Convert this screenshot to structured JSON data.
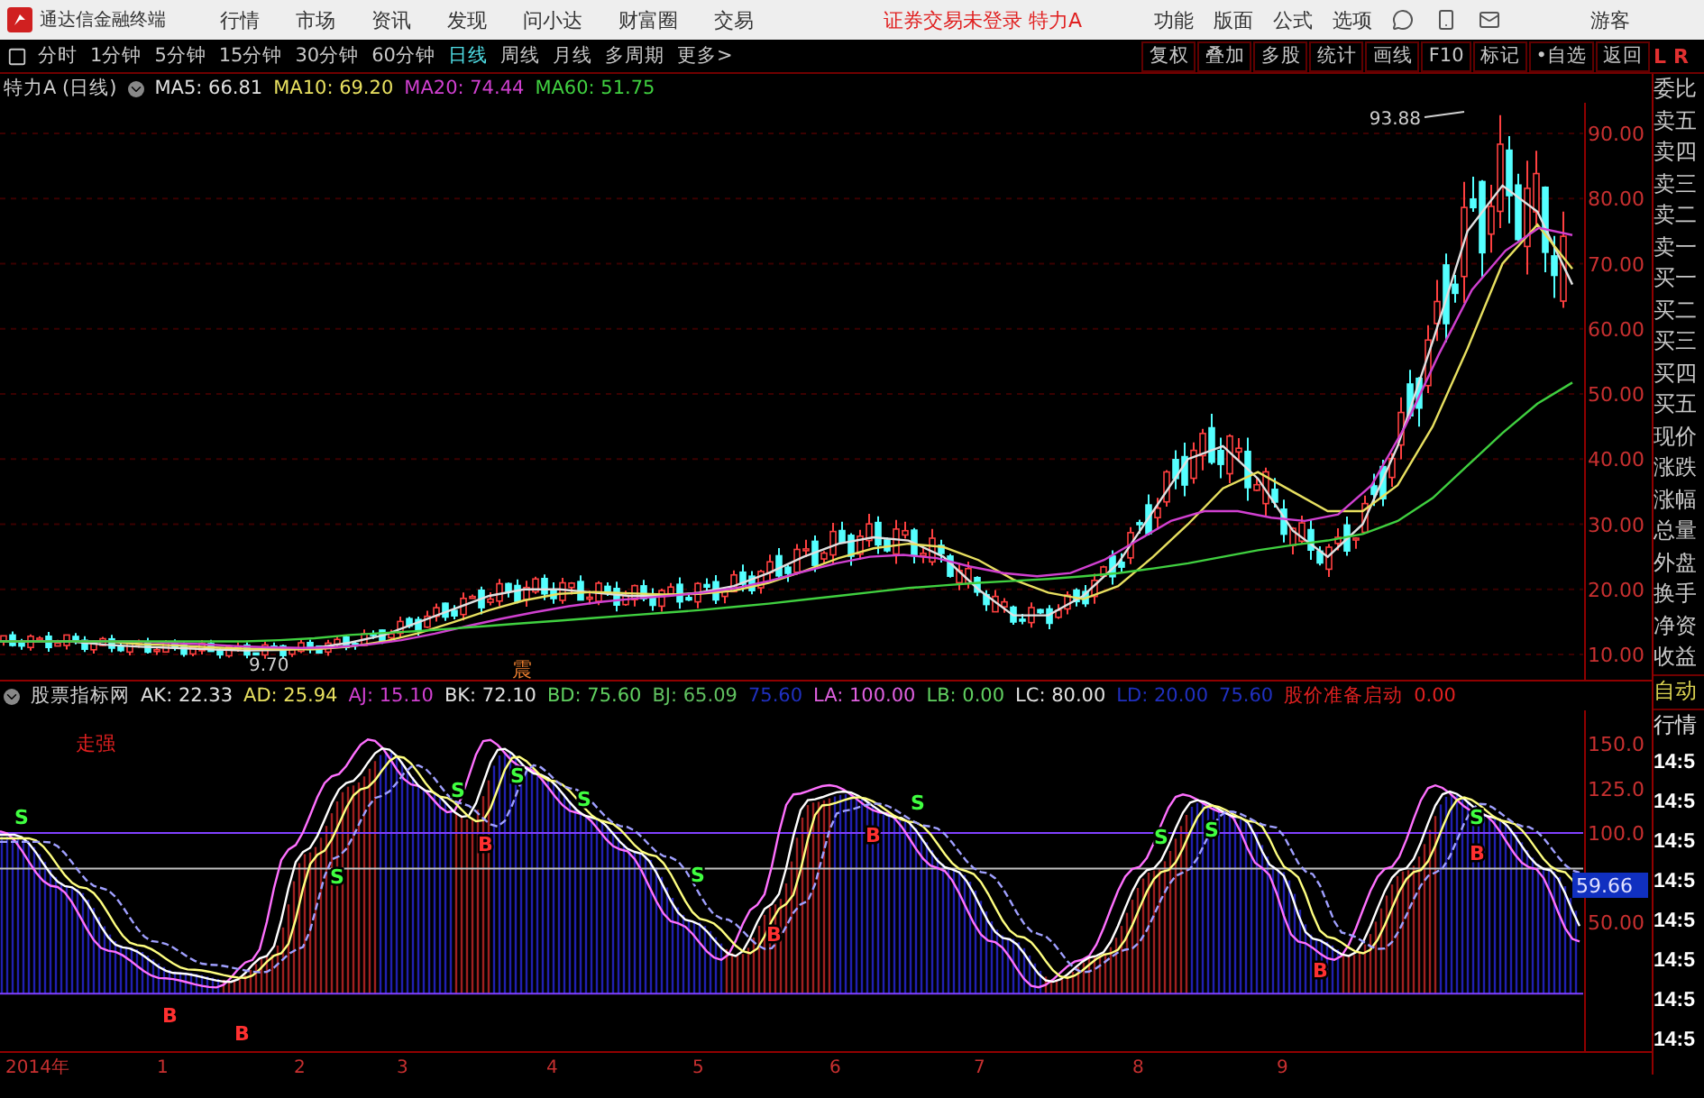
{
  "title_bar": {
    "app_name": "通达信金融终端",
    "menu": [
      "行情",
      "市场",
      "资讯",
      "发现",
      "问小达",
      "财富圈",
      "交易"
    ],
    "notice": "证券交易未登录 特力A",
    "right_menu": [
      "功能",
      "版面",
      "公式",
      "选项"
    ],
    "user": "游客"
  },
  "period_tabs": [
    {
      "label": "分时",
      "selected": false
    },
    {
      "label": "1分钟",
      "selected": false
    },
    {
      "label": "5分钟",
      "selected": false
    },
    {
      "label": "15分钟",
      "selected": false
    },
    {
      "label": "30分钟",
      "selected": false
    },
    {
      "label": "60分钟",
      "selected": false
    },
    {
      "label": "日线",
      "selected": true
    },
    {
      "label": "周线",
      "selected": false
    },
    {
      "label": "月线",
      "selected": false
    },
    {
      "label": "多周期",
      "selected": false
    },
    {
      "label": "更多>",
      "selected": false
    }
  ],
  "tools": [
    "复权",
    "叠加",
    "多股",
    "统计",
    "画线",
    "F10",
    "标记",
    "•自选",
    "返回"
  ],
  "corner": {
    "left": "L",
    "right": "R"
  },
  "main_chart": {
    "stock": "特力A",
    "period": "(日线)",
    "ma": [
      {
        "label": "MA5: 66.81",
        "color": "#e0e0e0"
      },
      {
        "label": "MA10: 69.20",
        "color": "#e8e060"
      },
      {
        "label": "MA20: 74.44",
        "color": "#d040d0"
      },
      {
        "label": "MA60: 51.75",
        "color": "#40d040"
      }
    ],
    "high_label": "93.88",
    "low_label": "9.70",
    "marker": "震",
    "price_axis": [
      "90.00",
      "80.00",
      "70.00",
      "60.00",
      "50.00",
      "40.00",
      "30.00",
      "20.00",
      "10.00"
    ]
  },
  "indicator": {
    "name": "股票指标网",
    "values": [
      {
        "label": "AK: 22.33",
        "color": "#e0e0e0"
      },
      {
        "label": "AD: 25.94",
        "color": "#e8e060"
      },
      {
        "label": "AJ: 15.10",
        "color": "#d040d0"
      },
      {
        "label": "BK: 72.10",
        "color": "#e0e0e0"
      },
      {
        "label": "BD: 75.60",
        "color": "#60d060"
      },
      {
        "label": "BJ: 65.09",
        "color": "#60c060"
      },
      {
        "label": "75.60",
        "color": "#2030c0"
      },
      {
        "label": "LA: 100.00",
        "color": "#e060e0"
      },
      {
        "label": "LB: 0.00",
        "color": "#60d060"
      },
      {
        "label": "LC: 80.00",
        "color": "#e0e0e0"
      },
      {
        "label": "LD: 20.00",
        "color": "#2030c0"
      },
      {
        "label": "75.60",
        "color": "#2030c0"
      },
      {
        "label": "股价准备启动",
        "color": "#e02020"
      },
      {
        "label": "0.00",
        "color": "#e02020"
      }
    ],
    "note": "走强",
    "axis": [
      "150.0",
      "125.0",
      "100.0",
      "50.00"
    ],
    "current": "59.66",
    "signals": [
      {
        "kind": "sell",
        "label": "S"
      },
      {
        "kind": "sell",
        "label": "S"
      },
      {
        "kind": "sell",
        "label": "S"
      },
      {
        "kind": "sell",
        "label": "S"
      },
      {
        "kind": "sell",
        "label": "S"
      },
      {
        "kind": "sell",
        "label": "S"
      },
      {
        "kind": "sell",
        "label": "S"
      },
      {
        "kind": "sell",
        "label": "S"
      },
      {
        "kind": "sell",
        "label": "S"
      },
      {
        "kind": "sell",
        "label": "S"
      },
      {
        "kind": "buy",
        "label": "B"
      },
      {
        "kind": "buy",
        "label": "B"
      },
      {
        "kind": "buy",
        "label": "B"
      },
      {
        "kind": "buy",
        "label": "B"
      },
      {
        "kind": "buy",
        "label": "B"
      },
      {
        "kind": "buy",
        "label": "B"
      },
      {
        "kind": "buy",
        "label": "B"
      }
    ]
  },
  "time_axis": [
    "2014年",
    "1",
    "2",
    "3",
    "4",
    "5",
    "6",
    "7",
    "8",
    "9"
  ],
  "quote_panel": {
    "labels": [
      "委比",
      "卖五",
      "卖四",
      "卖三",
      "卖二",
      "卖一",
      "买一",
      "买二",
      "买三",
      "买四",
      "买五",
      "现价",
      "涨跌",
      "涨幅",
      "总量",
      "外盘",
      "换手",
      "净资",
      "收益"
    ],
    "modes": [
      "自动",
      "行情"
    ],
    "times": [
      "14:5",
      "14:5",
      "14:5",
      "14:5",
      "14:5",
      "14:5",
      "14:5",
      "14:5"
    ]
  }
}
